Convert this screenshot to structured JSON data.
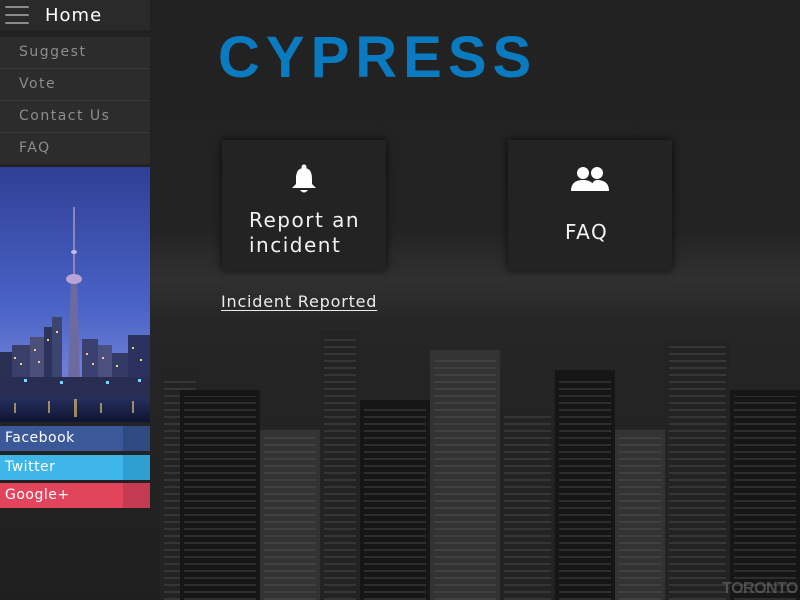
{
  "topbar": {
    "home_label": "Home"
  },
  "menu": {
    "items": [
      {
        "label": "Suggest"
      },
      {
        "label": "Vote"
      },
      {
        "label": "Contact Us"
      },
      {
        "label": "FAQ"
      }
    ]
  },
  "social": {
    "facebook": {
      "label": "Facebook",
      "color": "#3b5998",
      "tab_color": "#2f4a80"
    },
    "twitter": {
      "label": "Twitter",
      "color": "#3fb6ea",
      "tab_color": "#2e9fd0"
    },
    "google": {
      "label": "Google+",
      "color": "#e2445c",
      "tab_color": "#c43a50"
    }
  },
  "logo": {
    "text": "CYPRESS",
    "color": "#0a7bc0"
  },
  "cards": {
    "report": {
      "line1": "Report an",
      "line2": "incident",
      "icon": "bell-icon"
    },
    "faq": {
      "label": "FAQ",
      "icon": "users-icon"
    }
  },
  "status": {
    "incident_link": "Incident Reported"
  },
  "background": {
    "watermark": "TORONTO"
  }
}
